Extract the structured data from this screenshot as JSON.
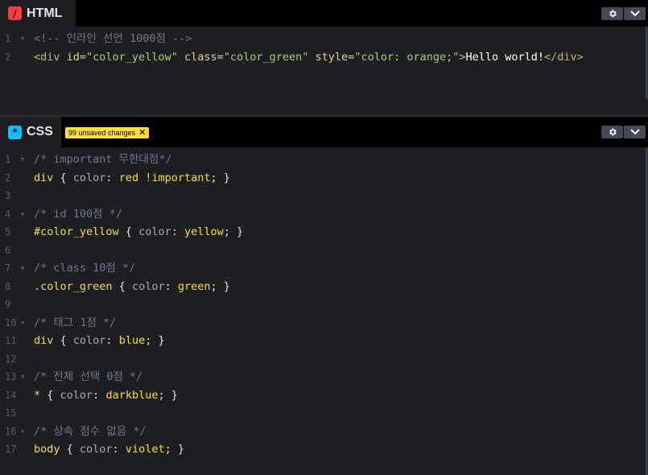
{
  "html_panel": {
    "icon_glyph": "/",
    "icon_color": "#ff3c41",
    "title": "HTML",
    "lines": [
      {
        "num": "1",
        "fold": "▼",
        "text": "<!-- 인라인 선언 1000점 -->"
      },
      {
        "num": "2",
        "fold": "",
        "text": ""
      }
    ],
    "line2": {
      "open_tag": "<div",
      "attr1_name": " id=",
      "attr1_val": "\"color_yellow\"",
      "attr2_name": " class=",
      "attr2_val": "\"color_green\"",
      "attr3_name": " style=",
      "attr3_val": "\"color: orange;\"",
      "close_bracket": ">",
      "content": "Hello world!",
      "end_tag": "</div>"
    }
  },
  "css_panel": {
    "icon_glyph": "*",
    "icon_color": "#0ebeff",
    "title": "CSS",
    "badge_text": "99 unsaved changes",
    "badge_close": "✕",
    "rules": [
      {
        "c1": "1",
        "comment": "/* important 무한대점*/",
        "c2": "2",
        "selector": "div",
        "prop": "color",
        "value": "red !important"
      },
      {
        "c1": "4",
        "comment": "/* id 100점 */",
        "c2": "5",
        "selector": "#color_yellow",
        "prop": "color",
        "value": "yellow"
      },
      {
        "c1": "7",
        "comment": "/* class 10점 */",
        "c2": "8",
        "selector": ".color_green",
        "prop": "color",
        "value": "green"
      },
      {
        "c1": "10",
        "comment": "/* 태그 1점 */",
        "c2": "11",
        "selector": "div",
        "prop": "color",
        "value": "blue"
      },
      {
        "c1": "13",
        "comment": "/* 전체 선택 0점 */",
        "c2": "14",
        "selector": "*",
        "prop": "color",
        "value": "darkblue"
      },
      {
        "c1": "16",
        "comment": "/* 상속 점수 없음 */",
        "c2": "17",
        "selector": "body",
        "prop": "color",
        "value": "violet"
      }
    ],
    "blank_lines": [
      "3",
      "6",
      "9",
      "12",
      "15"
    ]
  },
  "icons": {
    "gear": "gear-icon",
    "chevron": "chevron-down-icon",
    "fold": "fold-arrow-icon"
  }
}
